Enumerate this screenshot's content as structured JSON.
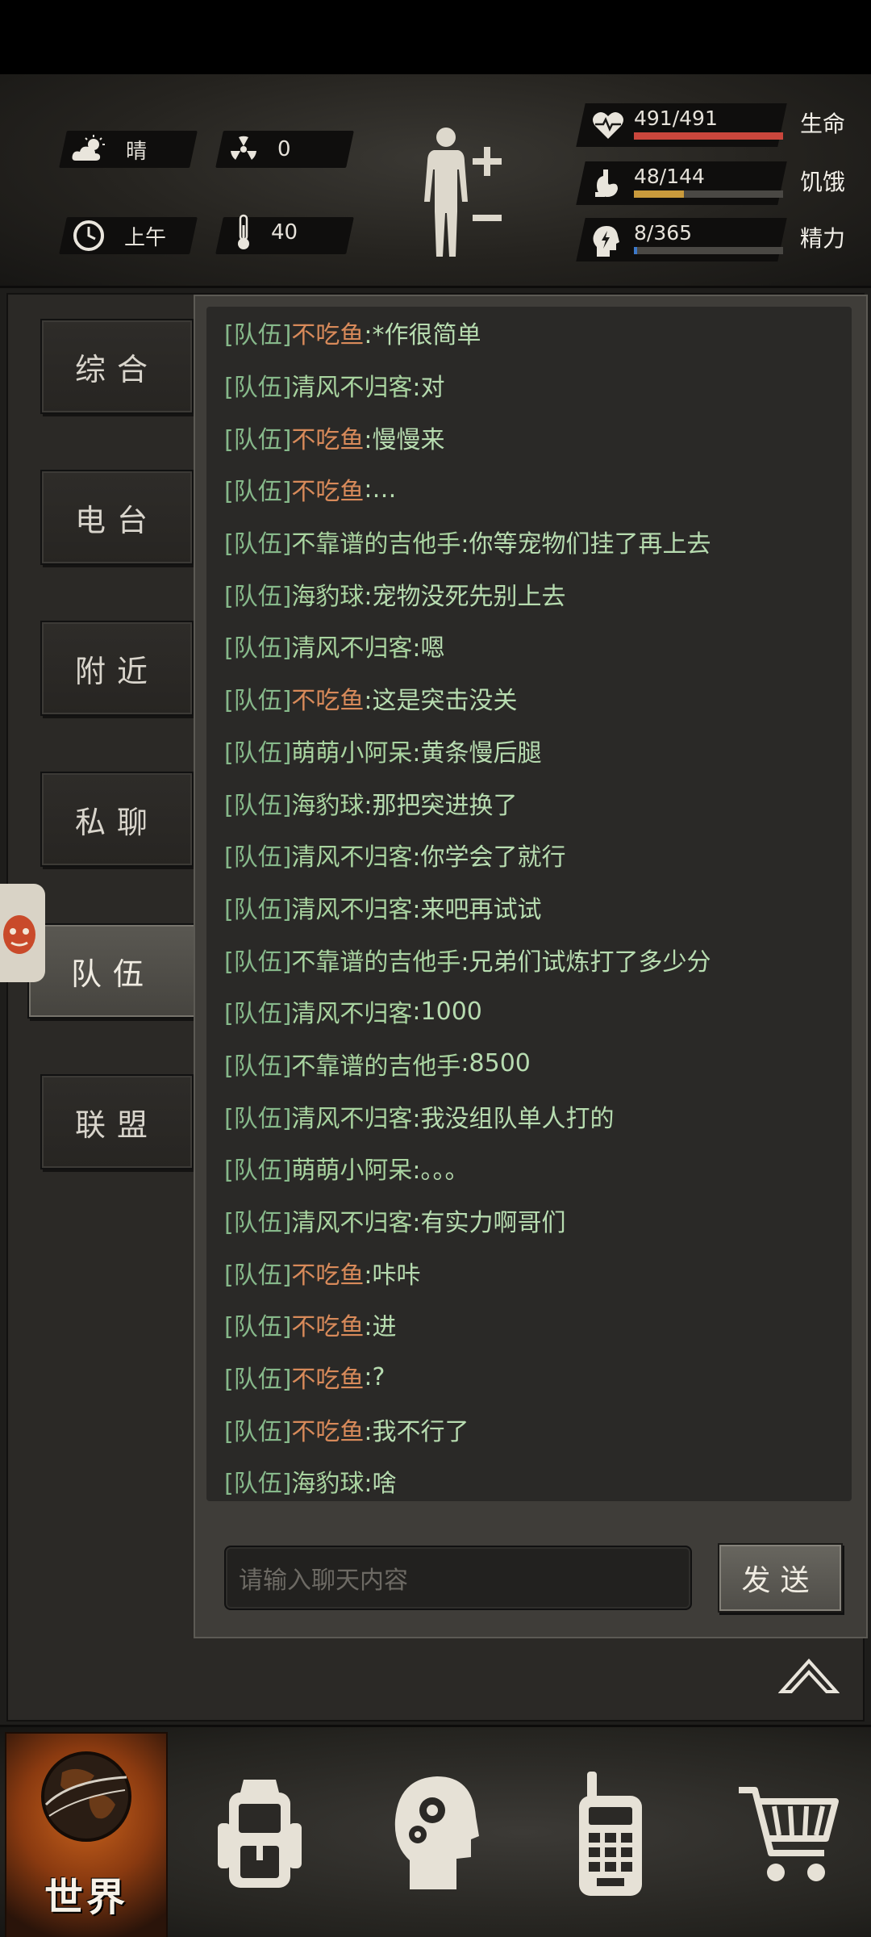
{
  "hud": {
    "weather": {
      "icon": "cloud-sun-icon",
      "label": "晴"
    },
    "radiation": {
      "icon": "radiation-icon",
      "value": "0"
    },
    "time": {
      "icon": "clock-icon",
      "label": "上午"
    },
    "temperature": {
      "icon": "thermometer-icon",
      "value": "40"
    },
    "stats": [
      {
        "icon": "heart-pulse-icon",
        "value": "491/491",
        "label": "生命",
        "fraction": 1.0,
        "color": "#c9463c"
      },
      {
        "icon": "stomach-icon",
        "value": "48/144",
        "label": "饥饿",
        "fraction": 0.333,
        "color": "#c99a3c"
      },
      {
        "icon": "energy-head-icon",
        "value": "8/365",
        "label": "精力",
        "fraction": 0.022,
        "color": "#3c78c9"
      }
    ]
  },
  "tabs": [
    {
      "id": "general",
      "label": "综合",
      "active": false
    },
    {
      "id": "radio",
      "label": "电台",
      "active": false
    },
    {
      "id": "nearby",
      "label": "附近",
      "active": false
    },
    {
      "id": "private",
      "label": "私聊",
      "active": false
    },
    {
      "id": "team",
      "label": "队伍",
      "active": true
    },
    {
      "id": "alliance",
      "label": "联盟",
      "active": false
    }
  ],
  "chat": {
    "messages": [
      {
        "channel": "[队伍]",
        "name": "不吃鱼",
        "name_color": "orange",
        "text": ":*作很简单"
      },
      {
        "channel": "[队伍]",
        "name": "清风不归客",
        "name_color": "green",
        "text": ":对"
      },
      {
        "channel": "[队伍]",
        "name": "不吃鱼",
        "name_color": "orange",
        "text": ":慢慢来"
      },
      {
        "channel": "[队伍]",
        "name": "不吃鱼",
        "name_color": "orange",
        "text": ":…"
      },
      {
        "channel": "[队伍]",
        "name": "不靠谱的吉他手",
        "name_color": "green",
        "text": ":你等宠物们挂了再上去"
      },
      {
        "channel": "[队伍]",
        "name": "海豹球",
        "name_color": "green",
        "text": ":宠物没死先别上去"
      },
      {
        "channel": "[队伍]",
        "name": "清风不归客",
        "name_color": "green",
        "text": ":嗯"
      },
      {
        "channel": "[队伍]",
        "name": "不吃鱼",
        "name_color": "orange",
        "text": ":这是突击没关"
      },
      {
        "channel": "[队伍]",
        "name": "萌萌小阿呆",
        "name_color": "green",
        "text": ":黄条慢后腿"
      },
      {
        "channel": "[队伍]",
        "name": "海豹球",
        "name_color": "green",
        "text": ":那把突进换了"
      },
      {
        "channel": "[队伍]",
        "name": "清风不归客",
        "name_color": "green",
        "text": ":你学会了就行"
      },
      {
        "channel": "[队伍]",
        "name": "清风不归客",
        "name_color": "green",
        "text": ":来吧再试试"
      },
      {
        "channel": "[队伍]",
        "name": "不靠谱的吉他手",
        "name_color": "green",
        "text": ":兄弟们试炼打了多少分"
      },
      {
        "channel": "[队伍]",
        "name": "清风不归客",
        "name_color": "green",
        "text": ":1000"
      },
      {
        "channel": "[队伍]",
        "name": "不靠谱的吉他手",
        "name_color": "green",
        "text": ":8500"
      },
      {
        "channel": "[队伍]",
        "name": "清风不归客",
        "name_color": "green",
        "text": ":我没组队单人打的"
      },
      {
        "channel": "[队伍]",
        "name": "萌萌小阿呆",
        "name_color": "green",
        "text": ":。。。"
      },
      {
        "channel": "[队伍]",
        "name": "清风不归客",
        "name_color": "green",
        "text": ":有实力啊哥们"
      },
      {
        "channel": "[队伍]",
        "name": "不吃鱼",
        "name_color": "orange",
        "text": ":咔咔"
      },
      {
        "channel": "[队伍]",
        "name": "不吃鱼",
        "name_color": "orange",
        "text": ":进"
      },
      {
        "channel": "[队伍]",
        "name": "不吃鱼",
        "name_color": "orange",
        "text": ":?"
      },
      {
        "channel": "[队伍]",
        "name": "不吃鱼",
        "name_color": "orange",
        "text": ":我不行了"
      },
      {
        "channel": "[队伍]",
        "name": "海豹球",
        "name_color": "green",
        "text": ":啥"
      }
    ],
    "input_placeholder": "请输入聊天内容",
    "send_label": "发送"
  },
  "nav": {
    "world_label": "世界",
    "items": [
      "backpack-icon",
      "skills-head-icon",
      "walkie-talkie-icon",
      "cart-icon"
    ]
  }
}
